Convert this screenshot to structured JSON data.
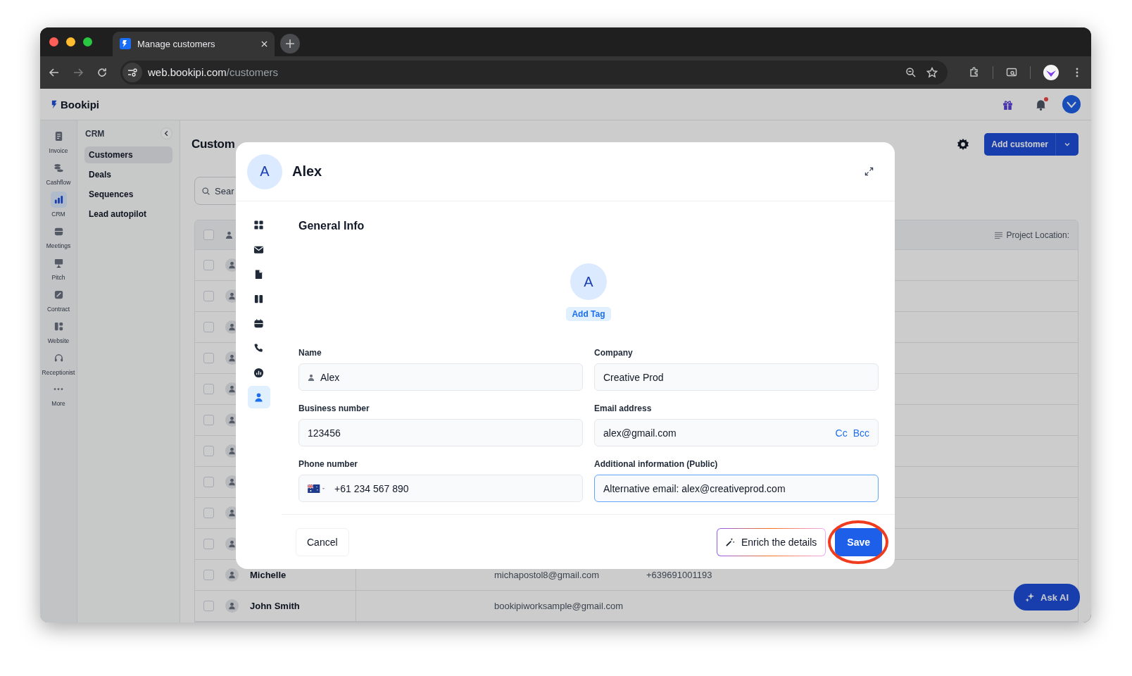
{
  "browser": {
    "tab_title": "Manage customers",
    "url_host": "web.bookipi.com",
    "url_path": "/customers"
  },
  "app": {
    "logo": "Bookipi",
    "notification_dot": true
  },
  "rail": [
    {
      "label": "Invoice",
      "selected": false
    },
    {
      "label": "Cashflow",
      "selected": false
    },
    {
      "label": "CRM",
      "selected": true
    },
    {
      "label": "Meetings",
      "selected": false
    },
    {
      "label": "Pitch",
      "selected": false
    },
    {
      "label": "Contract",
      "selected": false
    },
    {
      "label": "Website",
      "selected": false
    },
    {
      "label": "Receptionist",
      "selected": false
    },
    {
      "label": "More",
      "selected": false
    }
  ],
  "crm_panel": {
    "title": "CRM",
    "items": [
      {
        "label": "Customers",
        "selected": true
      },
      {
        "label": "Deals",
        "selected": false
      },
      {
        "label": "Sequences",
        "selected": false
      },
      {
        "label": "Lead autopilot",
        "selected": false
      }
    ]
  },
  "page": {
    "title": "Custom",
    "search_placeholder": "Sear",
    "add_button": "Add customer"
  },
  "table": {
    "header": {
      "checked": false,
      "column_last": "Project Location:"
    },
    "rows": [
      {
        "checked": false
      },
      {
        "checked": false
      },
      {
        "checked": false
      },
      {
        "checked": false
      },
      {
        "checked": false
      },
      {
        "checked": false
      },
      {
        "checked": false
      },
      {
        "checked": false
      },
      {
        "checked": false
      },
      {
        "checked": false
      },
      {
        "checked": false,
        "name": "Michelle",
        "email": "michapostol8@gmail.com",
        "phone": "+639691001193"
      },
      {
        "checked": false,
        "name": "John Smith",
        "email": "bookipiworksample@gmail.com"
      }
    ]
  },
  "ask_ai": "Ask AI",
  "modal": {
    "avatar": "A",
    "title": "Alex",
    "nav": [
      {
        "selected": false
      },
      {
        "selected": false
      },
      {
        "selected": false
      },
      {
        "selected": false
      },
      {
        "selected": false
      },
      {
        "selected": false
      },
      {
        "selected": false
      },
      {
        "selected": true
      }
    ],
    "section_title": "General Info",
    "profile_avatar": "A",
    "add_tag": "Add Tag",
    "fields": [
      {
        "kind": "person",
        "label": "Name",
        "value": "Alex",
        "focused": false
      },
      {
        "kind": "plain",
        "label": "Company",
        "value": "Creative Prod",
        "focused": false
      },
      {
        "kind": "plain",
        "label": "Business number",
        "value": "123456",
        "focused": false
      },
      {
        "kind": "email",
        "label": "Email address",
        "value": "alex@gmail.com",
        "cc": "Cc",
        "bcc": "Bcc",
        "focused": false
      },
      {
        "kind": "phone",
        "label": "Phone number",
        "value": "+61 234 567 890",
        "focused": false
      },
      {
        "kind": "plain",
        "label": "Additional information (Public)",
        "value": "Alternative email: alex@creativeprod.com",
        "focused": true
      }
    ],
    "cancel": "Cancel",
    "enrich": "Enrich the details",
    "save": "Save",
    "save_highlighted": true
  }
}
